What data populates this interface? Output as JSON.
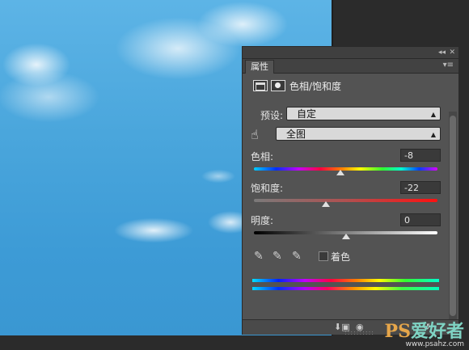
{
  "panel": {
    "tab_label": "属性",
    "header_title": "色相/饱和度",
    "preset_label": "预设:",
    "preset_value": "自定",
    "channel_value": "全图",
    "hue": {
      "label": "色相:",
      "value": "-8",
      "fraction": 0.473
    },
    "saturation": {
      "label": "饱和度:",
      "value": "-22",
      "fraction": 0.39
    },
    "lightness": {
      "label": "明度:",
      "value": "0",
      "fraction": 0.5
    },
    "colorize_label": "着色"
  },
  "watermark": {
    "logo_ps": "PS",
    "logo_cn": "爱好者",
    "url": "www.psahz.com"
  }
}
